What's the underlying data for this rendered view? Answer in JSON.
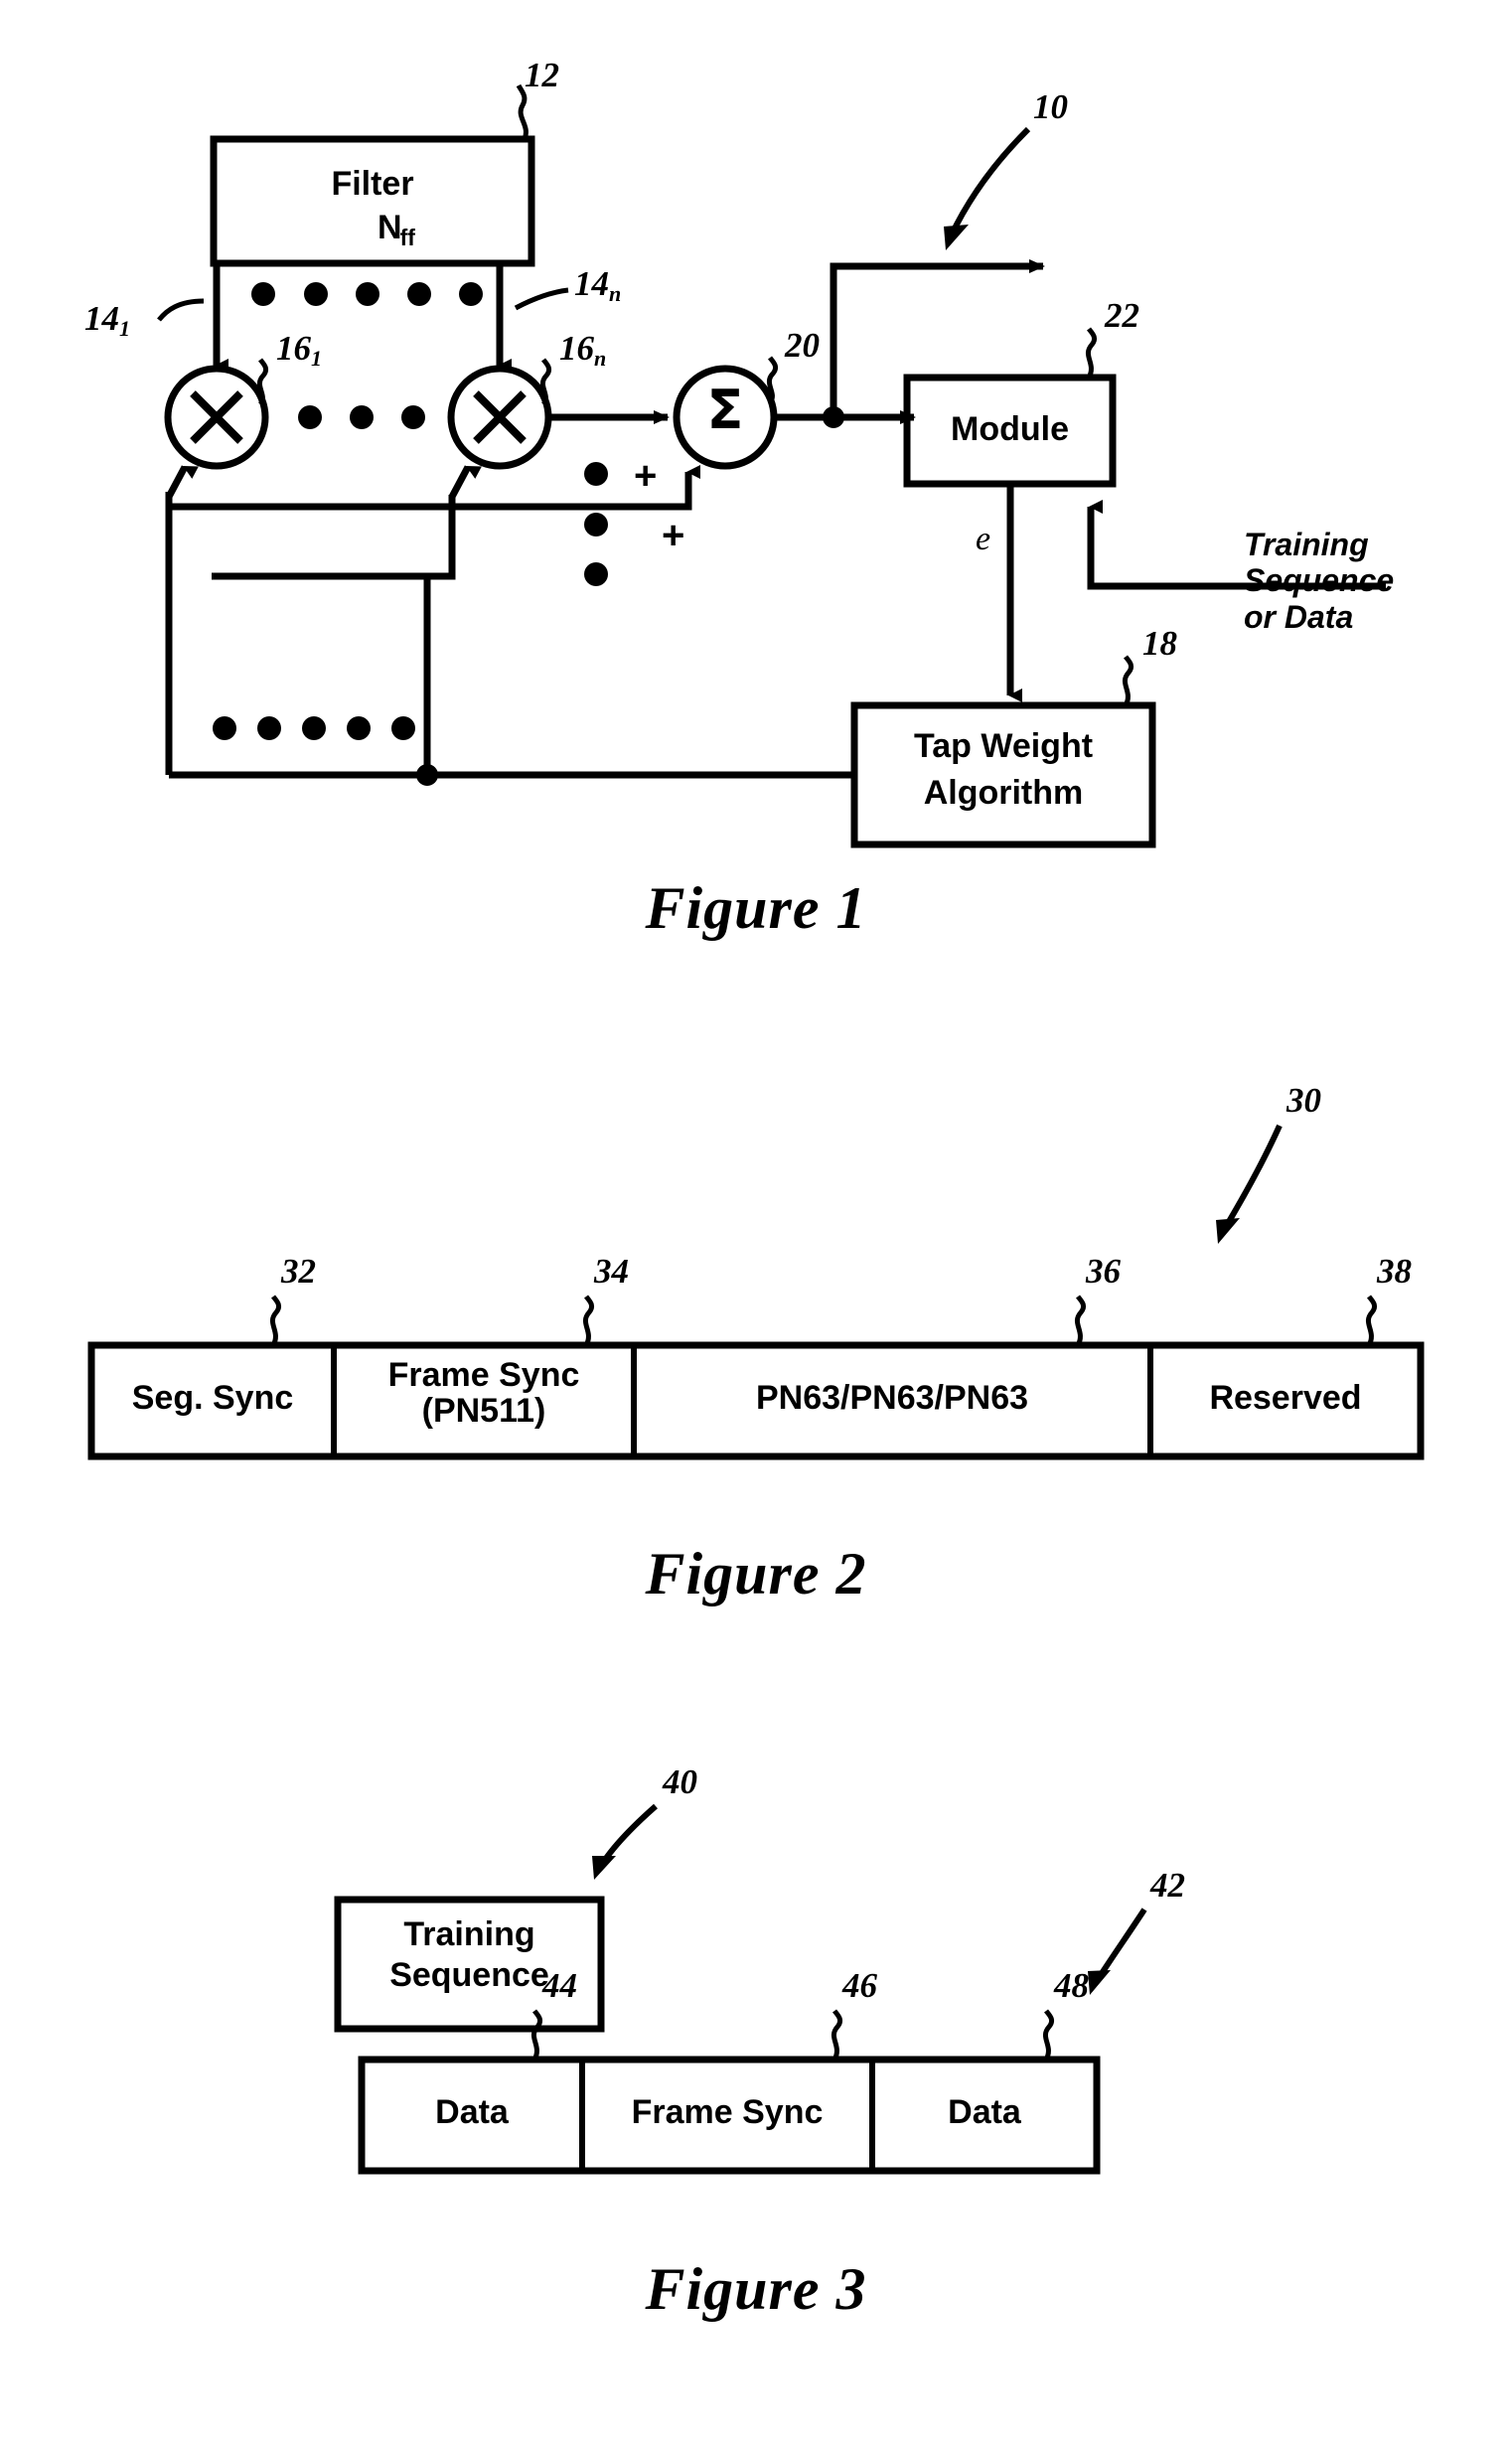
{
  "document": {
    "type": "patent-drawing-sheet",
    "figures": [
      {
        "caption": "Figure 1",
        "overall_ref": "10",
        "blocks": [
          {
            "ref": "12",
            "label_line1": "Filter",
            "label_line2": "N",
            "label_sub": "ff"
          },
          {
            "ref": "22",
            "label_line1": "Module"
          },
          {
            "ref": "18",
            "label_line1": "Tap Weight",
            "label_line2": "Algorithm"
          }
        ],
        "nodes": [
          {
            "ref": "14",
            "sub": "1",
            "kind": "tap-line"
          },
          {
            "ref": "14",
            "sub": "n",
            "kind": "tap-line"
          },
          {
            "ref": "16",
            "sub": "1",
            "kind": "multiplier",
            "glyph": "✕"
          },
          {
            "ref": "16",
            "sub": "n",
            "kind": "multiplier",
            "glyph": "✕"
          },
          {
            "ref": "20",
            "kind": "summer",
            "glyph": "Σ"
          }
        ],
        "signal_labels": [
          {
            "text": "e"
          },
          {
            "text": "Training\nSequence\nor Data"
          }
        ],
        "operators": [
          "+",
          "+"
        ]
      },
      {
        "caption": "Figure 2",
        "overall_ref": "30",
        "fields": [
          {
            "ref": "32",
            "label": "Seg. Sync"
          },
          {
            "ref": "34",
            "label": "Frame Sync\n(PN511)"
          },
          {
            "ref": "36",
            "label": "PN63/PN63/PN63"
          },
          {
            "ref": "38",
            "label": "Reserved"
          }
        ]
      },
      {
        "caption": "Figure 3",
        "overall_ref": "42",
        "training_block": {
          "ref": "40",
          "label": "Training\nSequence"
        },
        "fields": [
          {
            "ref": "44",
            "label": "Data"
          },
          {
            "ref": "46",
            "label": "Frame Sync"
          },
          {
            "ref": "48",
            "label": "Data"
          }
        ]
      }
    ]
  },
  "figure1": {
    "caption": "Figure 1",
    "ref_overall": "10",
    "filter": {
      "ref": "12",
      "line1": "Filter",
      "n": "N",
      "sub": "ff"
    },
    "module": {
      "ref": "22",
      "label": "Module"
    },
    "tapweight": {
      "ref": "18",
      "line1": "Tap Weight",
      "line2": "Algorithm"
    },
    "tap1": {
      "ref": "14",
      "sub": "1"
    },
    "tapn": {
      "ref": "14",
      "sub": "n"
    },
    "mult1": {
      "ref": "16",
      "sub": "1",
      "glyph": "✕"
    },
    "multn": {
      "ref": "16",
      "sub": "n",
      "glyph": "✕"
    },
    "summer": {
      "ref": "20",
      "glyph": "Σ"
    },
    "error_label": "e",
    "training_label": "Training\nSequence\nor Data",
    "plus1": "+",
    "plus2": "+"
  },
  "figure2": {
    "caption": "Figure 2",
    "ref_overall": "30",
    "fields": [
      {
        "ref": "32",
        "label": "Seg. Sync"
      },
      {
        "ref": "34",
        "label": "Frame Sync\n(PN511)"
      },
      {
        "ref": "36",
        "label": "PN63/PN63/PN63"
      },
      {
        "ref": "38",
        "label": "Reserved"
      }
    ]
  },
  "figure3": {
    "caption": "Figure 3",
    "ref_training": "40",
    "ref_overall": "42",
    "training_block": "Training\nSequence",
    "fields": [
      {
        "ref": "44",
        "label": "Data"
      },
      {
        "ref": "46",
        "label": "Frame Sync"
      },
      {
        "ref": "48",
        "label": "Data"
      }
    ]
  },
  "colors": {
    "ink": "#000000",
    "paper": "#ffffff"
  }
}
